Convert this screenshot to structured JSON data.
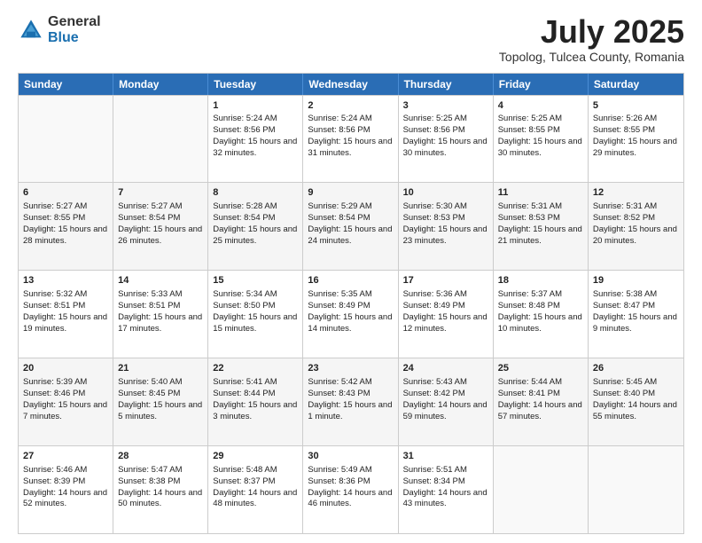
{
  "logo": {
    "general": "General",
    "blue": "Blue"
  },
  "header": {
    "month": "July 2025",
    "location": "Topolog, Tulcea County, Romania"
  },
  "weekdays": [
    "Sunday",
    "Monday",
    "Tuesday",
    "Wednesday",
    "Thursday",
    "Friday",
    "Saturday"
  ],
  "rows": [
    [
      {
        "day": "",
        "info": ""
      },
      {
        "day": "",
        "info": ""
      },
      {
        "day": "1",
        "info": "Sunrise: 5:24 AM\nSunset: 8:56 PM\nDaylight: 15 hours and 32 minutes."
      },
      {
        "day": "2",
        "info": "Sunrise: 5:24 AM\nSunset: 8:56 PM\nDaylight: 15 hours and 31 minutes."
      },
      {
        "day": "3",
        "info": "Sunrise: 5:25 AM\nSunset: 8:56 PM\nDaylight: 15 hours and 30 minutes."
      },
      {
        "day": "4",
        "info": "Sunrise: 5:25 AM\nSunset: 8:55 PM\nDaylight: 15 hours and 30 minutes."
      },
      {
        "day": "5",
        "info": "Sunrise: 5:26 AM\nSunset: 8:55 PM\nDaylight: 15 hours and 29 minutes."
      }
    ],
    [
      {
        "day": "6",
        "info": "Sunrise: 5:27 AM\nSunset: 8:55 PM\nDaylight: 15 hours and 28 minutes."
      },
      {
        "day": "7",
        "info": "Sunrise: 5:27 AM\nSunset: 8:54 PM\nDaylight: 15 hours and 26 minutes."
      },
      {
        "day": "8",
        "info": "Sunrise: 5:28 AM\nSunset: 8:54 PM\nDaylight: 15 hours and 25 minutes."
      },
      {
        "day": "9",
        "info": "Sunrise: 5:29 AM\nSunset: 8:54 PM\nDaylight: 15 hours and 24 minutes."
      },
      {
        "day": "10",
        "info": "Sunrise: 5:30 AM\nSunset: 8:53 PM\nDaylight: 15 hours and 23 minutes."
      },
      {
        "day": "11",
        "info": "Sunrise: 5:31 AM\nSunset: 8:53 PM\nDaylight: 15 hours and 21 minutes."
      },
      {
        "day": "12",
        "info": "Sunrise: 5:31 AM\nSunset: 8:52 PM\nDaylight: 15 hours and 20 minutes."
      }
    ],
    [
      {
        "day": "13",
        "info": "Sunrise: 5:32 AM\nSunset: 8:51 PM\nDaylight: 15 hours and 19 minutes."
      },
      {
        "day": "14",
        "info": "Sunrise: 5:33 AM\nSunset: 8:51 PM\nDaylight: 15 hours and 17 minutes."
      },
      {
        "day": "15",
        "info": "Sunrise: 5:34 AM\nSunset: 8:50 PM\nDaylight: 15 hours and 15 minutes."
      },
      {
        "day": "16",
        "info": "Sunrise: 5:35 AM\nSunset: 8:49 PM\nDaylight: 15 hours and 14 minutes."
      },
      {
        "day": "17",
        "info": "Sunrise: 5:36 AM\nSunset: 8:49 PM\nDaylight: 15 hours and 12 minutes."
      },
      {
        "day": "18",
        "info": "Sunrise: 5:37 AM\nSunset: 8:48 PM\nDaylight: 15 hours and 10 minutes."
      },
      {
        "day": "19",
        "info": "Sunrise: 5:38 AM\nSunset: 8:47 PM\nDaylight: 15 hours and 9 minutes."
      }
    ],
    [
      {
        "day": "20",
        "info": "Sunrise: 5:39 AM\nSunset: 8:46 PM\nDaylight: 15 hours and 7 minutes."
      },
      {
        "day": "21",
        "info": "Sunrise: 5:40 AM\nSunset: 8:45 PM\nDaylight: 15 hours and 5 minutes."
      },
      {
        "day": "22",
        "info": "Sunrise: 5:41 AM\nSunset: 8:44 PM\nDaylight: 15 hours and 3 minutes."
      },
      {
        "day": "23",
        "info": "Sunrise: 5:42 AM\nSunset: 8:43 PM\nDaylight: 15 hours and 1 minute."
      },
      {
        "day": "24",
        "info": "Sunrise: 5:43 AM\nSunset: 8:42 PM\nDaylight: 14 hours and 59 minutes."
      },
      {
        "day": "25",
        "info": "Sunrise: 5:44 AM\nSunset: 8:41 PM\nDaylight: 14 hours and 57 minutes."
      },
      {
        "day": "26",
        "info": "Sunrise: 5:45 AM\nSunset: 8:40 PM\nDaylight: 14 hours and 55 minutes."
      }
    ],
    [
      {
        "day": "27",
        "info": "Sunrise: 5:46 AM\nSunset: 8:39 PM\nDaylight: 14 hours and 52 minutes."
      },
      {
        "day": "28",
        "info": "Sunrise: 5:47 AM\nSunset: 8:38 PM\nDaylight: 14 hours and 50 minutes."
      },
      {
        "day": "29",
        "info": "Sunrise: 5:48 AM\nSunset: 8:37 PM\nDaylight: 14 hours and 48 minutes."
      },
      {
        "day": "30",
        "info": "Sunrise: 5:49 AM\nSunset: 8:36 PM\nDaylight: 14 hours and 46 minutes."
      },
      {
        "day": "31",
        "info": "Sunrise: 5:51 AM\nSunset: 8:34 PM\nDaylight: 14 hours and 43 minutes."
      },
      {
        "day": "",
        "info": ""
      },
      {
        "day": "",
        "info": ""
      }
    ]
  ]
}
